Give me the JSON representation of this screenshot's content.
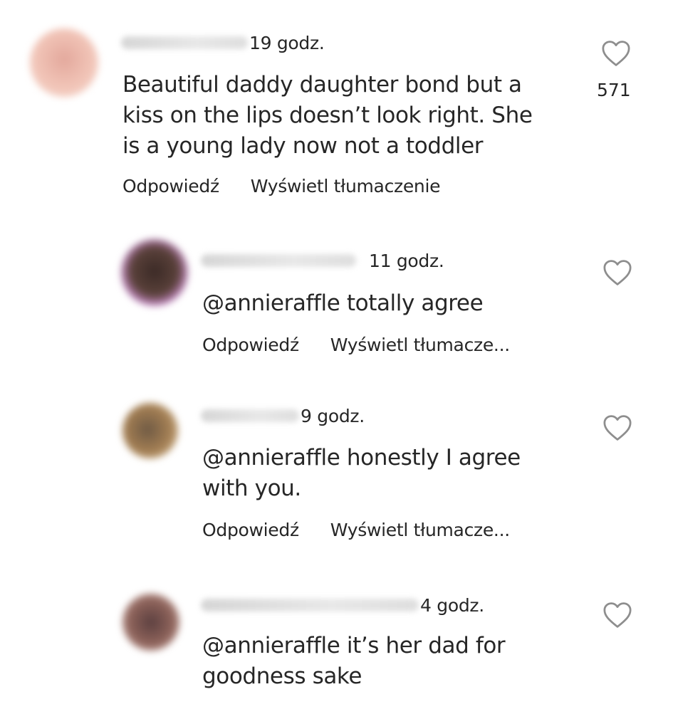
{
  "comments": [
    {
      "time": "19 godz.",
      "text_lines": [
        "Beautiful daddy daughter bond but a",
        "kiss on the lips doesn’t look right. She",
        "is a young lady now not a toddler"
      ],
      "reply_label": "Odpowiedź",
      "translate_label": "Wyświetl tłumaczenie",
      "likes": "571",
      "avatar_color": "#e9b3a8"
    },
    {
      "time": "11 godz.",
      "text_lines": [
        "@annieraffle totally agree"
      ],
      "reply_label": "Odpowiedź",
      "translate_label": "Wyświetl tłumacze...",
      "avatar_color": "#4a3530",
      "avatar_ring": "#e59be0"
    },
    {
      "time": "9 godz.",
      "text_lines": [
        "@annieraffle honestly I agree",
        "with you."
      ],
      "reply_label": "Odpowiedź",
      "translate_label": "Wyświetl tłumacze...",
      "avatar_color": "#8a6a48"
    },
    {
      "time": "4 godz.",
      "text_lines": [
        "@annieraffle it’s her dad for",
        "goodness sake"
      ],
      "avatar_color": "#7a5550"
    }
  ],
  "icons": {
    "like": "heart-outline-icon"
  }
}
